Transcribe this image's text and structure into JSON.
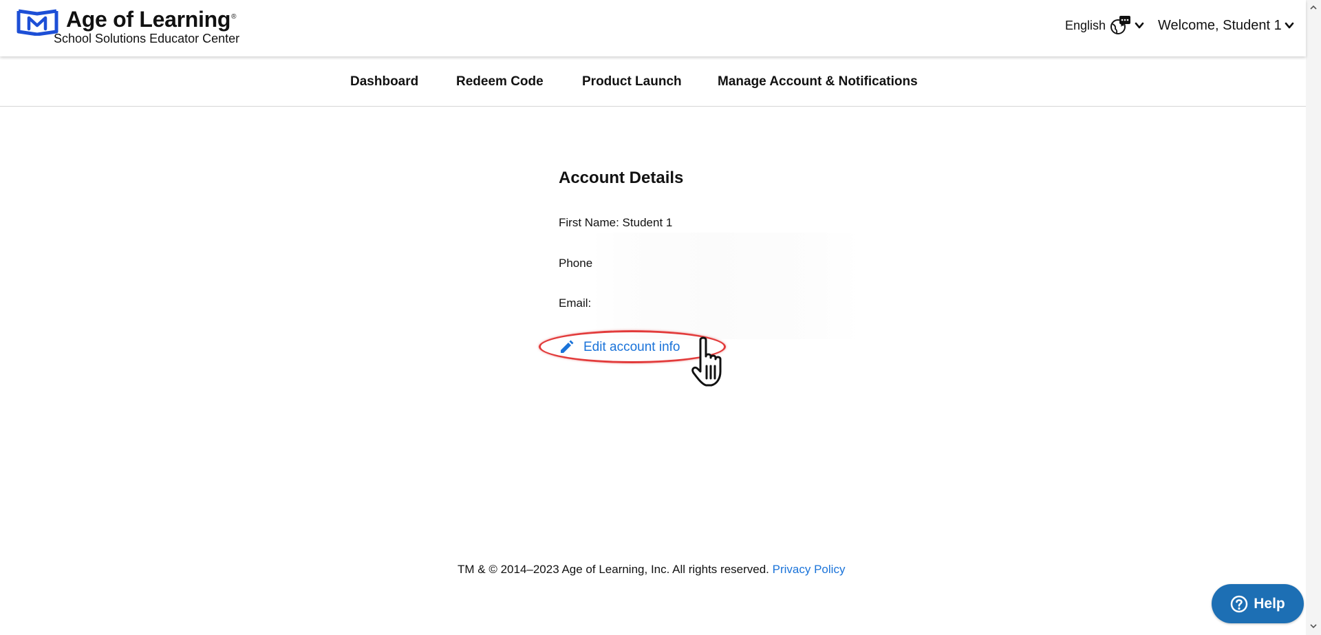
{
  "header": {
    "brand_title": "Age of Learning",
    "brand_reg": "®",
    "brand_subtitle": "School Solutions Educator Center",
    "language_label": "English",
    "welcome_label": "Welcome, Student 1"
  },
  "nav": {
    "items": [
      {
        "label": "Dashboard"
      },
      {
        "label": "Redeem Code"
      },
      {
        "label": "Product Launch"
      },
      {
        "label": "Manage Account & Notifications"
      }
    ]
  },
  "account": {
    "title": "Account Details",
    "first_name": "First Name: Student 1",
    "phone": "Phone",
    "email": "Email:",
    "edit_label": "Edit account info"
  },
  "footer": {
    "copyright": "TM & © 2014–2023 Age of Learning, Inc. All rights reserved.",
    "privacy_label": "Privacy Policy"
  },
  "help": {
    "label": "Help"
  },
  "colors": {
    "brand_blue": "#1d4fd6",
    "link_blue": "#1a73d9",
    "help_blue": "#1d6fb4",
    "highlight_red": "#e23b3b"
  },
  "icons": [
    "logo-mark-icon",
    "language-globe-icon",
    "chevron-down-icon",
    "pencil-icon",
    "hand-pointer-cursor-icon",
    "question-circle-icon",
    "scroll-up-icon",
    "scroll-down-icon"
  ]
}
